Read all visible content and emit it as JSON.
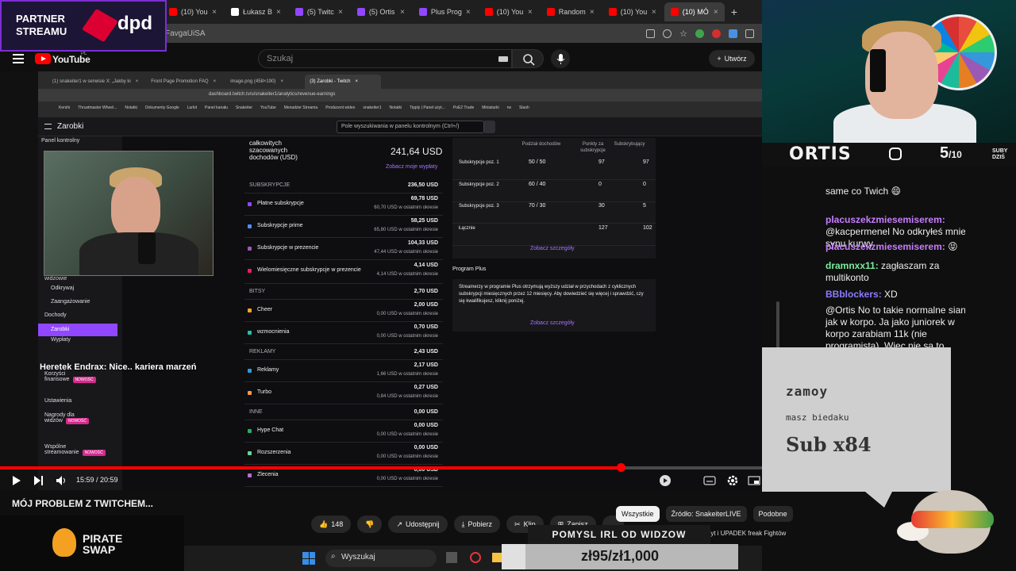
{
  "partner": {
    "line1": "PARTNER",
    "line2": "STREAMU",
    "brand": "dpd"
  },
  "browser": {
    "tabs": [
      {
        "label": "(10) You",
        "color": "#ff0000"
      },
      {
        "label": "Łukasz B",
        "color": "#ffffff"
      },
      {
        "label": "(5) Twitc",
        "color": "#9146ff"
      },
      {
        "label": "(5) Ortis",
        "color": "#9146ff"
      },
      {
        "label": "Plus Prog",
        "color": "#9146ff"
      },
      {
        "label": "(10) You",
        "color": "#ff0000"
      },
      {
        "label": "Random",
        "color": "#ff0000"
      },
      {
        "label": "(10) You",
        "color": "#ff0000"
      },
      {
        "label": "(10) MÓ",
        "color": "#ff0000",
        "active": true
      }
    ],
    "address_fragment": "FavgaUiSA"
  },
  "youtube": {
    "logo_text": "YouTube",
    "region": "PL",
    "search_placeholder": "Szukaj",
    "create_label": "Utwórz"
  },
  "inner_browser": {
    "tabs": [
      "(1) snakeiter1 w serwisie X: „Jakby ki",
      "Front Page Promotion FAQ",
      "image.png (458×190)",
      "(3) Zarobki - Twitch"
    ],
    "url": "dashboard.twitch.tv/u/snakeiter1/analytics/revenue-earnings",
    "bookmarks": [
      "Kershi",
      "Thrustmaster Wheel...",
      "Notatki",
      "Dokumenty Google",
      "Lurkit",
      "Panel kanału",
      "Snakeiter",
      "YouTube",
      "Menadżer Streama",
      "Producent wideo",
      "snakeiter1",
      "Notatki",
      "Tipply | Panel użyt...",
      "PoE2 Trade",
      "Miniaturki",
      "rw",
      "Stash"
    ]
  },
  "dashboard": {
    "title": "Zarobki",
    "search_placeholder": "Pole wyszukiwania w panelu kontrolnym (Ctrl+/)",
    "sidebar": {
      "header": "Panel kontrolny",
      "section": "widzowie",
      "items": [
        {
          "label": "Odkrywaj",
          "sub": true
        },
        {
          "label": "Zaangażowanie",
          "sub": true
        },
        {
          "label": "Dochody",
          "sub": false
        },
        {
          "label": "Zarobki",
          "sub": true,
          "active": true
        },
        {
          "label": "Wypłaty",
          "sub": true
        },
        {
          "label": "Korzyści finansowe",
          "badge": "NOWOŚĆ"
        },
        {
          "label": "Ustawienia"
        },
        {
          "label": "Nagrody dla widzów",
          "badge": "NOWOŚĆ"
        },
        {
          "label": "Wspólne streamowanie",
          "badge": "NOWOŚĆ"
        }
      ]
    },
    "total": {
      "label": "całkowitych szacowanych dochodów (USD)",
      "value": "241,64 USD",
      "link": "Zobacz moje wypłaty"
    },
    "revenue_rows": [
      {
        "type": "head",
        "label": "SUBSKRYPCJE",
        "value": "236,50 USD"
      },
      {
        "type": "item",
        "label": "Płatne subskrypcje",
        "value": "69,78 USD",
        "sub": "60,70 USD w ostatnim okresie",
        "color": "#9147ff"
      },
      {
        "type": "item",
        "label": "Subskrypcje prime",
        "value": "58,25 USD",
        "sub": "65,80 USD w ostatnim okresie",
        "color": "#4c8ef7"
      },
      {
        "type": "item",
        "label": "Subskrypcje w prezencie",
        "value": "104,33 USD",
        "sub": "47,44 USD w ostatnim okresie",
        "color": "#9b59b6"
      },
      {
        "type": "item",
        "label": "Wielomiesięczne subskrypcje w prezencie",
        "value": "4,14 USD",
        "sub": "4,14 USD w ostatnim okresie",
        "color": "#e91e63"
      },
      {
        "type": "head",
        "label": "BITSY",
        "value": "2,70 USD"
      },
      {
        "type": "item",
        "label": "Cheer",
        "value": "2,00 USD",
        "sub": "0,00 USD w ostatnim okresie",
        "color": "#f5a623"
      },
      {
        "type": "item",
        "label": "wzmocnienia",
        "value": "0,70 USD",
        "sub": "0,00 USD w ostatnim okresie",
        "color": "#1fc2a7"
      },
      {
        "type": "head",
        "label": "REKLAMY",
        "value": "2,43 USD"
      },
      {
        "type": "item",
        "label": "Reklamy",
        "value": "2,17 USD",
        "sub": "1,66 USD w ostatnim okresie",
        "color": "#2d9cdb"
      },
      {
        "type": "item",
        "label": "Turbo",
        "value": "0,27 USD",
        "sub": "0,84 USD w ostatnim okresie",
        "color": "#f2994a"
      },
      {
        "type": "head",
        "label": "INNE",
        "value": "0,00 USD"
      },
      {
        "type": "item",
        "label": "Hype Chat",
        "value": "0,00 USD",
        "sub": "0,00 USD w ostatnim okresie",
        "color": "#27ae60"
      },
      {
        "type": "item",
        "label": "Rozszerzenia",
        "value": "0,00 USD",
        "sub": "0,00 USD w ostatnim okresie",
        "color": "#6fcf97"
      },
      {
        "type": "item",
        "label": "Zlecenia",
        "value": "0,00 USD",
        "sub": "0,00 USD w ostatnim okresie",
        "color": "#bb6bd9"
      }
    ],
    "sub_table": {
      "headers": [
        "Podział dochodów",
        "Punkty za subskrypcje",
        "Subskrybujący"
      ],
      "rows": [
        {
          "name": "Subskrypcje poz. 1",
          "split": "50 / 50",
          "points": "97",
          "subs": "97"
        },
        {
          "name": "Subskrypcje poz. 2",
          "split": "60 / 40",
          "points": "0",
          "subs": "0"
        },
        {
          "name": "Subskrypcje poz. 3",
          "split": "70 / 30",
          "points": "30",
          "subs": "5"
        },
        {
          "name": "Łącznie",
          "split": "",
          "points": "127",
          "subs": "102"
        }
      ],
      "link": "Zobacz szczegóły"
    },
    "plus": {
      "title": "Program Plus",
      "text": "Streamerzy w programie Plus otrzymują wyższy udział w przychodach z cyklicznych subskrypcji miesięcznych przez 12 miesięcy. Aby dowiedzieć się więcej i sprawdzić, czy się kwalifikujesz, kliknij poniżej.",
      "link": "Zobacz szczegóły"
    }
  },
  "overlay_chat_line": "Heretek Endrax: Nice.. kariera marzeń",
  "player": {
    "time": "15:59 / 20:59",
    "progress": 0.815
  },
  "video_title": "MÓJ PROBLEM Z TWITCHEM...",
  "chips": [
    {
      "label": "Wszystkie",
      "active": true
    },
    {
      "label": "Źródło: SnakeiterLIVE"
    },
    {
      "label": "Podobne"
    }
  ],
  "actions": {
    "likes": "148",
    "share": "Udostępnij",
    "download": "Pobierz",
    "clip": "Klip",
    "save": "Zapisz",
    "more": "..."
  },
  "pirate": {
    "line1": "PIRATE",
    "line2": "SWAP"
  },
  "taskbar": {
    "search": "Wyszukaj"
  },
  "stream": {
    "name": "ORTIS",
    "sub_count": "5",
    "sub_target": "/10",
    "sub_label1": "SUBY",
    "sub_label2": "DZIŚ"
  },
  "chat": [
    {
      "user": "",
      "text": "same co Twich 😄",
      "color": "#efeff1"
    },
    {
      "user": "placuszekzmiesemiserem:",
      "text": "@kacpermenel No odkryłeś mnie synu kurwy",
      "color": "#c77dff"
    },
    {
      "user": "placuszekzmiesemiserem:",
      "text": "😝",
      "color": "#c77dff"
    },
    {
      "user": "dramnxx11:",
      "text": "zagłaszam za multikonto",
      "color": "#7bed9f"
    },
    {
      "user": "BBblockers:",
      "text": "XD",
      "color": "#8c7bff"
    },
    {
      "user": "",
      "text": "@Ortis No to takie normalne siano jak w korpo. Ja jako juniorek w korpo zarabiam 11k (nie programista). Więc nie są to",
      "color": "#efeff1"
    }
  ],
  "alert": {
    "user": "zamoy",
    "message": "masz biedaku",
    "sub": "Sub x84"
  },
  "pomysl": "POMYSL IRL OD WIDZOW",
  "goal": "zł95/zł1,000",
  "ticker": "Szczyt i UPADEK freak Fightów"
}
